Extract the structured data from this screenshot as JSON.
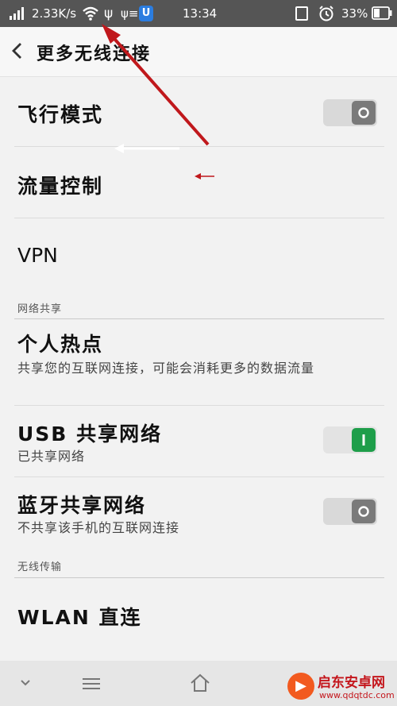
{
  "status_bar": {
    "net_speed": "2.33K/s",
    "time": "13:34",
    "battery": "33%",
    "icons": [
      "signal-icon",
      "wifi-icon",
      "usb-icon",
      "usb-debug-icon",
      "shield-app-icon",
      "vibrate-icon",
      "alarm-icon",
      "battery-icon"
    ]
  },
  "header": {
    "title": "更多无线连接"
  },
  "items": {
    "airplane": {
      "label": "飞行模式"
    },
    "traffic": {
      "label": "流量控制"
    },
    "vpn": {
      "label": "VPN"
    },
    "hotspot": {
      "label": "个人热点",
      "desc": "共享您的互联网连接，可能会消耗更多的数据流量"
    },
    "usb_share": {
      "label": "USB 共享网络",
      "desc": "已共享网络"
    },
    "bt_share": {
      "label": "蓝牙共享网络",
      "desc": "不共享该手机的互联网连接"
    },
    "wlan_direct": {
      "label": "WLAN 直连"
    }
  },
  "sections": {
    "network_sharing": "网络共享",
    "wireless_transfer": "无线传输"
  },
  "toggles": {
    "airplane": "off",
    "usb_share": "on",
    "bt_share": "off"
  },
  "colors": {
    "toggle_on": "#1e9e4a",
    "toggle_off": "#7a7a7a",
    "annotation_arrow": "#c0181c"
  },
  "nav_bar": {
    "icons": [
      "chevron-down-icon",
      "menu-icon",
      "home-icon"
    ]
  },
  "watermark": {
    "brand": "启东安卓网",
    "url": "www.qdqtdc.com"
  }
}
